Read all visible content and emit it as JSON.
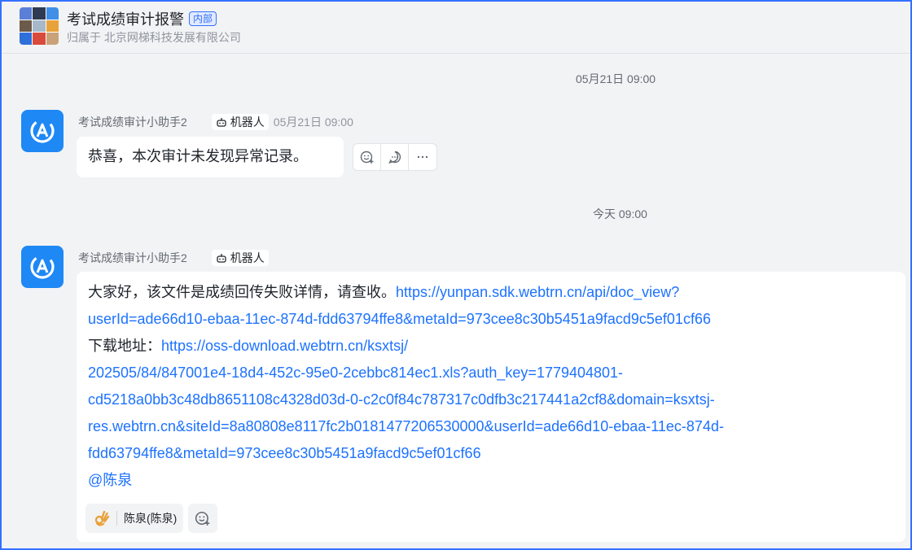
{
  "header": {
    "title": "考试成绩审计报警",
    "tag": "内部",
    "subtitle": "归属于 北京网梯科技发展有限公司"
  },
  "dividers": [
    "05月21日 09:00",
    "今天 09:00"
  ],
  "messages": [
    {
      "sender": "考试成绩审计小助手2",
      "bot_tag": "机器人",
      "time": "05月21日 09:00",
      "text": "恭喜，本次审计未发现异常记录。"
    },
    {
      "sender": "考试成绩审计小助手2",
      "bot_tag": "机器人",
      "line1_text": "大家好，该文件是成绩回传失败详情，请查收。",
      "link1_part1": "https://yunpan.sdk.webtrn.cn/api/doc_view?",
      "link1_part2": "userId=ade66d10-ebaa-11ec-874d-fdd63794ffe8&metaId=973cee8c30b5451a9facd9c5ef01cf66",
      "download_label": "下载地址：",
      "link2_part1": "https://oss-download.webtrn.cn/ksxtsj/",
      "link2_part2": "202505/84/847001e4-18d4-452c-95e0-2cebbc814ec1.xls?auth_key=1779404801-",
      "link2_part3": "cd5218a0bb3c48db8651108c4328d03d-0-c2c0f84c787317c0dfb3c217441a2cf8&domain=ksxtsj-",
      "link2_part4": "res.webtrn.cn&siteId=8a80808e8117fc2b0181477206530000&userId=ade66d10-ebaa-11ec-874d-",
      "link2_part5": "fdd63794ffe8&metaId=973cee8c30b5451a9facd9c5ef01cf66",
      "mention": "@陈泉",
      "reaction_user": "陈泉(陈泉)"
    }
  ],
  "colors": {
    "accent": "#3370ff",
    "bot_avatar": "#1e88f5",
    "link": "#1d72ff"
  }
}
